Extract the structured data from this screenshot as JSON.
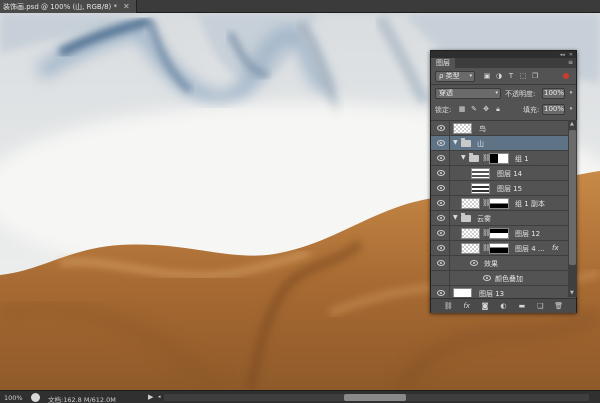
{
  "document_tab": {
    "title": "装饰画.psd @ 100% (山, RGB/8) *",
    "close": "✕"
  },
  "layers_panel": {
    "tab_label": "图层",
    "filter": {
      "kind_label": "ρ 类型"
    },
    "blend_mode": "穿透",
    "opacity_label": "不透明度:",
    "opacity_value": "100%",
    "lock_label": "锁定:",
    "fill_label": "填充:",
    "fill_value": "100%",
    "layers": [
      {
        "name": "鸟",
        "type": "layer"
      },
      {
        "name": "山",
        "type": "group",
        "selected": true
      },
      {
        "name": "组 1",
        "type": "group-masked"
      },
      {
        "name": "图层 14",
        "type": "layer"
      },
      {
        "name": "图层 15",
        "type": "layer"
      },
      {
        "name": "组 1 副本",
        "type": "group-masked"
      },
      {
        "name": "云雾",
        "type": "group"
      },
      {
        "name": "图层 12",
        "type": "layer-masked"
      },
      {
        "name": "图层 4 ...",
        "type": "layer-masked",
        "fx": "fx"
      },
      {
        "name": "效果",
        "type": "effects-header"
      },
      {
        "name": "颜色叠加",
        "type": "effect"
      },
      {
        "name": "图层 13",
        "type": "layer"
      }
    ],
    "footer_icons": [
      "link-icon",
      "fx-icon",
      "mask-icon",
      "adjustment-icon",
      "folder-icon",
      "new-layer-icon",
      "trash-icon"
    ]
  },
  "status_bar": {
    "zoom": "100%",
    "doc_info": "文档:162.8 M/612.0M"
  }
}
